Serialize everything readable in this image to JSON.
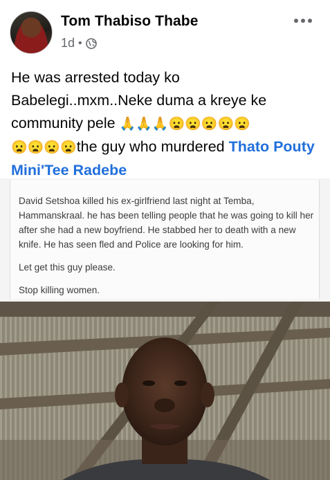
{
  "post": {
    "author": "Tom Thabiso Thabe",
    "time": "1d",
    "meta_separator": "•",
    "privacy_icon": "globe-icon",
    "more_icon": "more-horizontal-icon",
    "text_line1": "He was arrested today ko",
    "text_line2": "Babelegi..mxm..Neke duma  a kreye ke",
    "text_line3_pre": "community pele ",
    "text_line4_post": "the guy who murdered ",
    "mention": "Thato Pouty Mini'Tee Radebe",
    "emoji_pray": "🙏",
    "emoji_frown": "😦",
    "pray_count": 3,
    "frown_count_line3": 5,
    "frown_count_line4": 4
  },
  "embedded": {
    "paragraph1": "David Setshoa killed his ex-girlfriend last night at Temba, Hammanskraal. he has been telling people that he was going to kill her after she had a new boyfriend. He stabbed her to death with a new knife. He has seen fled and Police are looking for him.",
    "paragraph2": "Let get this guy please.",
    "paragraph3": "Stop killing women."
  },
  "colors": {
    "mention": "#216fdb",
    "meta": "#65676b"
  },
  "photo": {
    "description_icon": "photo-of-man-under-corrugated-roof"
  }
}
